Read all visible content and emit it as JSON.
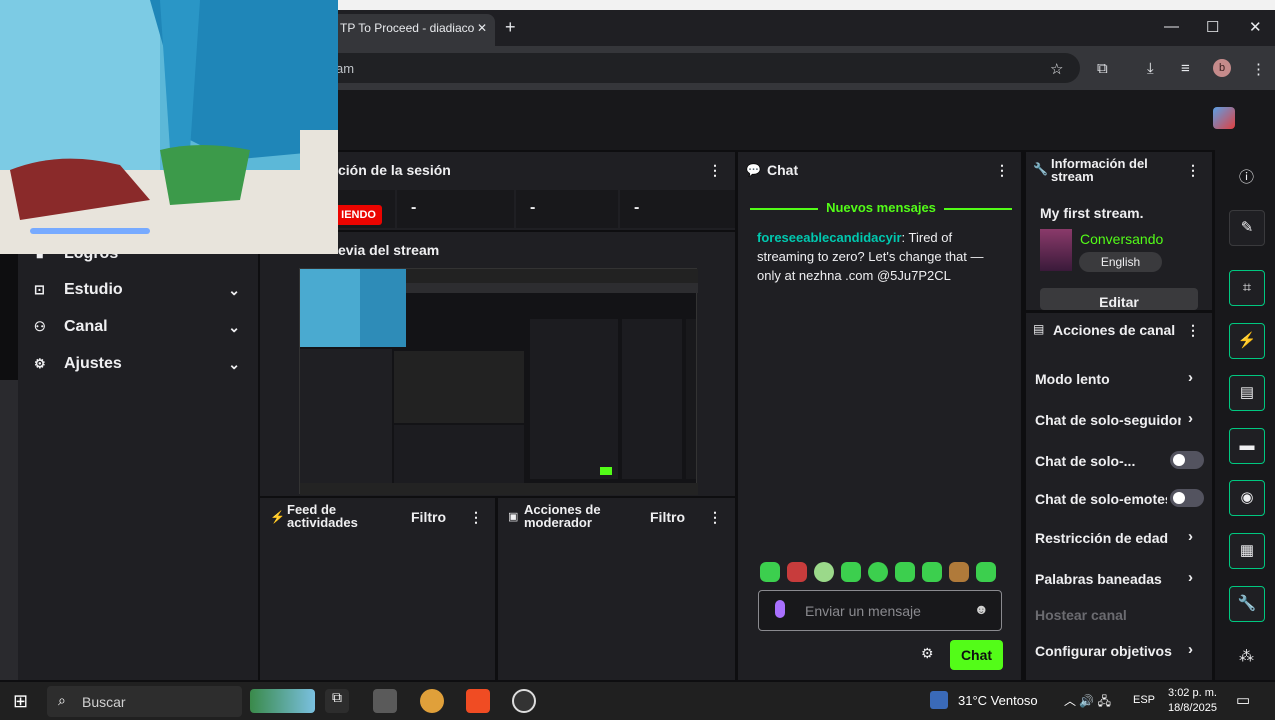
{
  "browser": {
    "tab_title": "TP To Proceed - diadiaco",
    "tab_close": "✕",
    "new_tab": "+",
    "url_fragment": "am",
    "profile_initial": "b",
    "window_controls": [
      "—",
      "☐",
      "✕"
    ]
  },
  "session": {
    "title": "ción de la sesión",
    "live_label": "IENDO",
    "stats": [
      "-",
      "-",
      "-"
    ]
  },
  "preview": {
    "title": "evia del stream"
  },
  "sidebar": {
    "items": [
      {
        "label": "Logros",
        "icon": "trophy-icon"
      },
      {
        "label": "Estudio",
        "icon": "studio-icon"
      },
      {
        "label": "Canal",
        "icon": "channel-icon"
      },
      {
        "label": "Ajustes",
        "icon": "settings-icon"
      }
    ]
  },
  "feed": {
    "title": "Feed de actividades",
    "filter": "Filtro"
  },
  "mod_actions": {
    "title": "Acciones de moderador",
    "filter": "Filtro"
  },
  "chat": {
    "title": "Chat",
    "new_messages": "Nuevos mensajes",
    "message": {
      "user": "foreseeablecandidacyir",
      "text": ": Tired of streaming to zero? Let's change that — only at nezhna .com @5Ju7P2CL"
    },
    "input_placeholder": "Enviar un mensaje",
    "send_label": "Chat"
  },
  "stream_info": {
    "title": "Información del stream",
    "stream_title": "My first stream.",
    "category": "Conversando",
    "language": "English",
    "edit_label": "Editar"
  },
  "channel_actions": {
    "title": "Acciones de canal",
    "items": [
      {
        "label": "Modo lento",
        "control": "chevron"
      },
      {
        "label": "Chat de solo-seguidore",
        "control": "chevron"
      },
      {
        "label": "Chat de solo-...",
        "control": "toggle"
      },
      {
        "label": "Chat de solo-emotes",
        "control": "toggle"
      },
      {
        "label": "Restricción de edad",
        "control": "chevron"
      },
      {
        "label": "Palabras baneadas",
        "control": "chevron"
      },
      {
        "label": "Hostear canal",
        "control": "disabled"
      },
      {
        "label": "Configurar objetivos",
        "control": "chevron"
      }
    ]
  },
  "taskbar": {
    "search": "Buscar",
    "weather_temp": "31°C",
    "weather_text": "Ventoso",
    "lang": "ESP",
    "time": "3:02 p. m.",
    "date": "18/8/2025"
  },
  "colors": {
    "accent": "#53fc18",
    "live": "#eb0400",
    "rail_border": "#00c880",
    "username": "#00c8af"
  }
}
